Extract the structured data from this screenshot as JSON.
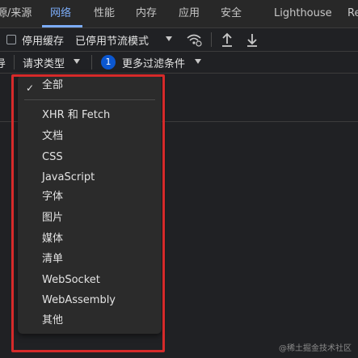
{
  "tabs": [
    {
      "label": "源/来源",
      "active": false
    },
    {
      "label": "网络",
      "active": true
    },
    {
      "label": "性能",
      "active": false
    },
    {
      "label": "内存",
      "active": false
    },
    {
      "label": "应用",
      "active": false
    },
    {
      "label": "安全",
      "active": false
    },
    {
      "label": "Lighthouse",
      "active": false
    },
    {
      "label": "Re",
      "active": false
    }
  ],
  "toolbar": {
    "disable_cache_label": "停用缓存",
    "throttle_label": "已停用节流模式",
    "icons": [
      "wifi-settings-icon",
      "upload-icon",
      "download-icon"
    ]
  },
  "filter_bar": {
    "left_fragment": "导",
    "request_type_label": "请求类型",
    "more_filters_count": "1",
    "more_filters_label": "更多过滤条件"
  },
  "request_type_menu": {
    "selected": "全部",
    "items": [
      "XHR 和 Fetch",
      "文档",
      "CSS",
      "JavaScript",
      "字体",
      "图片",
      "媒体",
      "清单",
      "WebSocket",
      "WebAssembly",
      "其他"
    ]
  },
  "watermark": "@稀土掘金技术社区",
  "colors": {
    "accent": "#7cacf8",
    "highlight": "#d62a2a",
    "badge": "#0b57d0"
  }
}
